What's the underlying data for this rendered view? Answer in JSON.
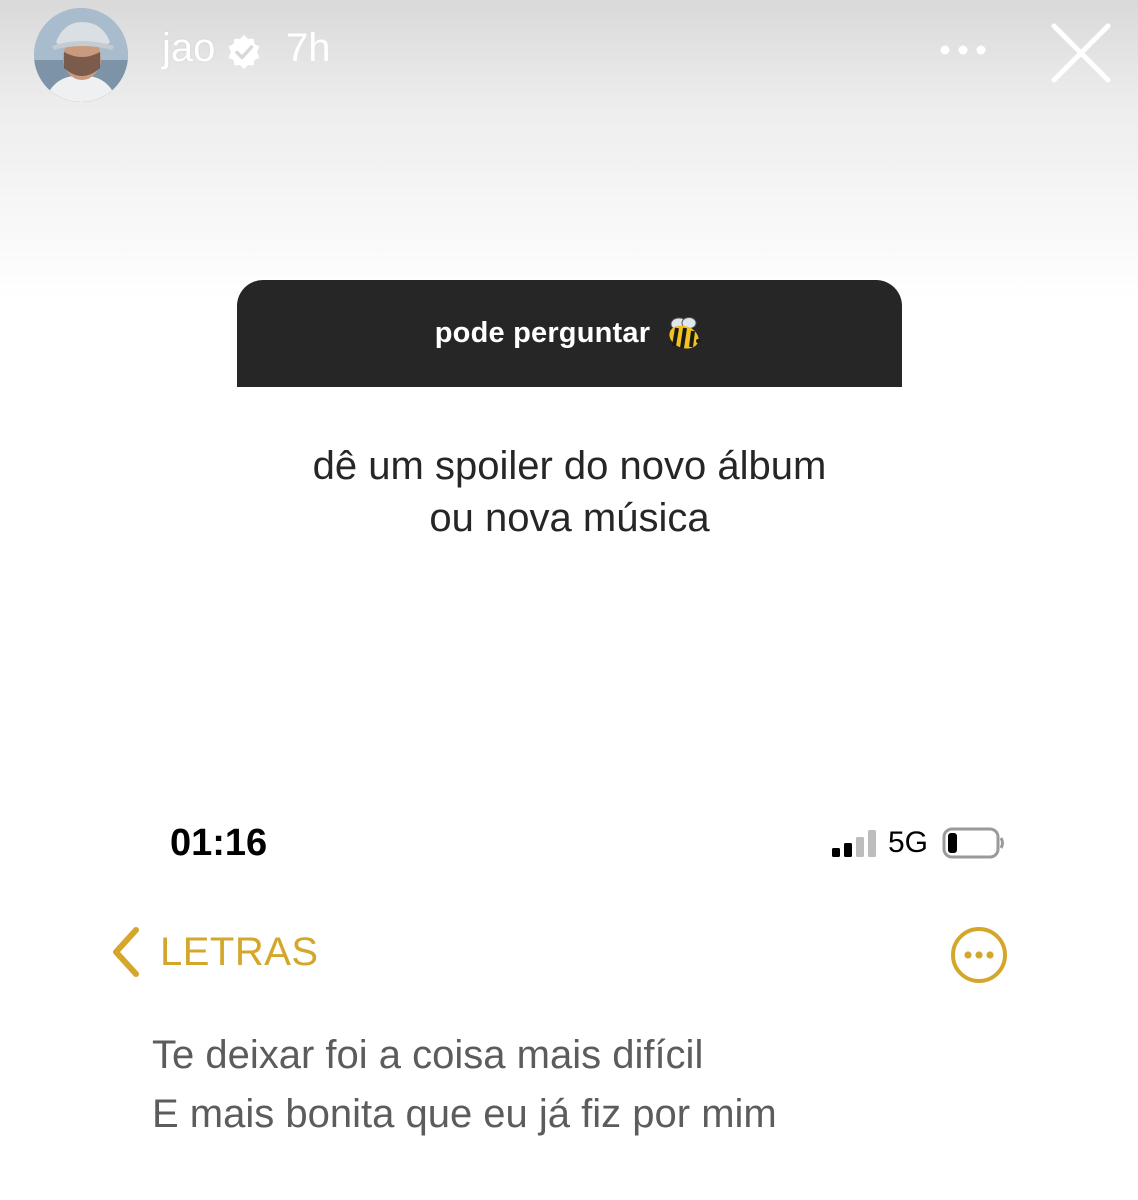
{
  "story": {
    "username": "jao",
    "time": "7h",
    "icons": {
      "avatar": "profile-photo",
      "verified": "verified-badge-icon",
      "more": "more-horizontal-icon",
      "close": "close-icon"
    }
  },
  "question_sticker": {
    "title": "pode perguntar",
    "emoji": "bee-icon",
    "question_lines": [
      "dê um spoiler do novo álbum",
      "ou nova música"
    ]
  },
  "screenshot": {
    "status_bar": {
      "time": "01:16",
      "network": "5G",
      "icons": {
        "signal": "cellular-signal-icon",
        "battery": "battery-icon"
      }
    },
    "nav": {
      "back_label": "LETRAS",
      "icons": {
        "back": "chevron-left-icon",
        "more": "more-circle-icon"
      }
    },
    "lyrics": [
      "Te deixar foi a coisa mais difícil",
      "E mais bonita que eu já fiz por mim"
    ]
  },
  "colors": {
    "accent_gold": "#d4a72c",
    "sticker_bg": "#262626",
    "lyrics_text": "#5c5c5c"
  }
}
